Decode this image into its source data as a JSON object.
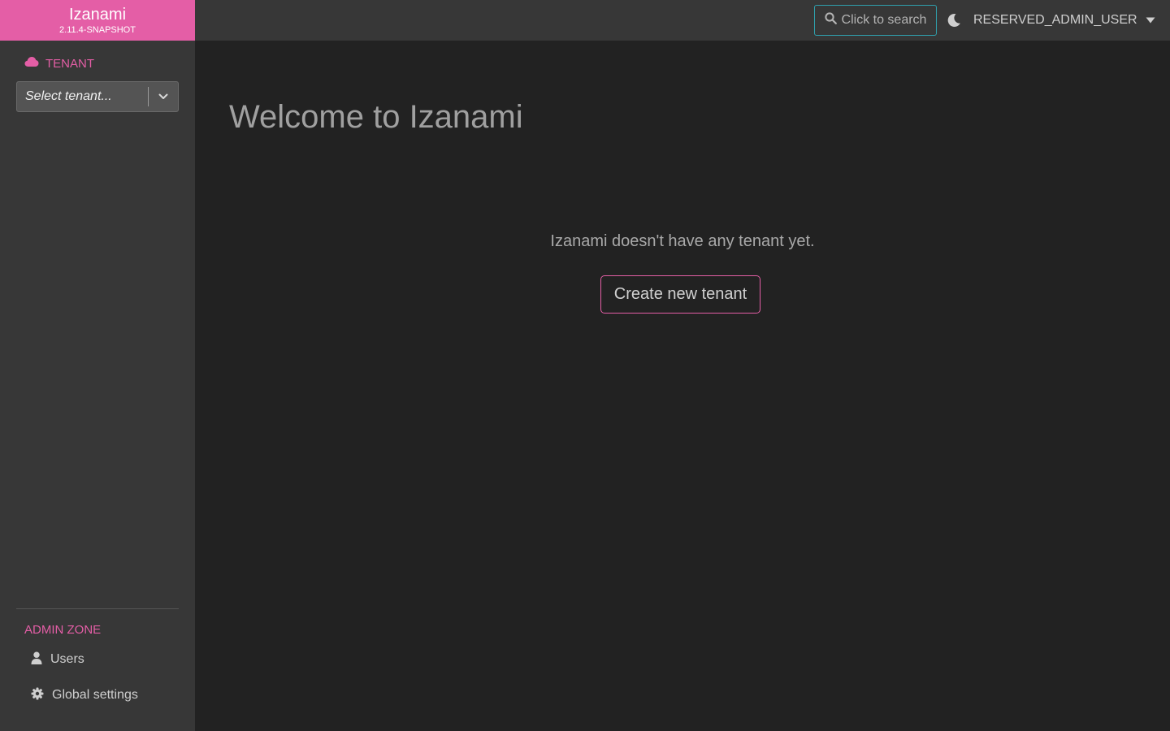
{
  "brand": {
    "name": "Izanami",
    "version": "2.11.4-SNAPSHOT",
    "color": "#e45ea6"
  },
  "sidebar": {
    "tenant_heading": "TENANT",
    "tenant_icon": "cloud-icon",
    "tenant_select": {
      "placeholder": "Select tenant..."
    },
    "admin_zone": {
      "title": "ADMIN ZONE",
      "items": [
        {
          "label": "Users",
          "icon": "user-icon"
        },
        {
          "label": "Global settings",
          "icon": "gear-icon"
        }
      ]
    }
  },
  "topbar": {
    "search_label": "Click to search",
    "search_icon": "search-icon",
    "theme_icon": "moon-icon",
    "user_name": "RESERVED_ADMIN_USER"
  },
  "main": {
    "title": "Welcome to Izanami",
    "empty_message": "Izanami doesn't have any tenant yet.",
    "create_button": "Create new tenant"
  },
  "colors": {
    "accent": "#e45ea6",
    "search_border": "#2fa0ad",
    "background": "#222222",
    "panel": "#373737"
  }
}
